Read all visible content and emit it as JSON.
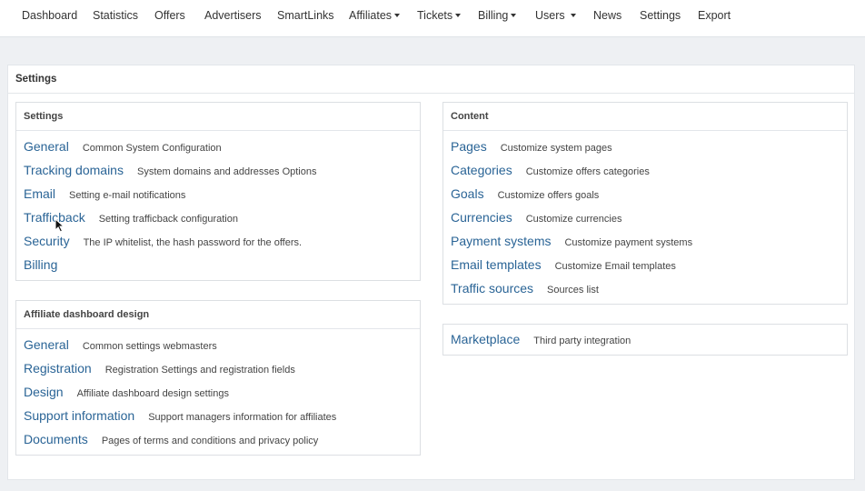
{
  "nav": {
    "items": [
      {
        "label": "Dashboard",
        "dropdown": false
      },
      {
        "label": "Statistics",
        "dropdown": false
      },
      {
        "label": "Offers",
        "dropdown": false
      },
      {
        "label": "Advertisers",
        "dropdown": false
      },
      {
        "label": "SmartLinks",
        "dropdown": false
      },
      {
        "label": "Affiliates",
        "dropdown": true
      },
      {
        "label": "Tickets",
        "dropdown": true
      },
      {
        "label": "Billing",
        "dropdown": true
      },
      {
        "label": "Users",
        "dropdown": true
      },
      {
        "label": "News",
        "dropdown": false
      },
      {
        "label": "Settings",
        "dropdown": false
      },
      {
        "label": "Export",
        "dropdown": false
      }
    ]
  },
  "main": {
    "title": "Settings"
  },
  "settings_panel": {
    "title": "Settings",
    "rows": [
      {
        "link": "General",
        "desc": "Common System Configuration"
      },
      {
        "link": "Tracking domains",
        "desc": "System domains and addresses Options"
      },
      {
        "link": "Email",
        "desc": "Setting e-mail notifications"
      },
      {
        "link": "Trafficback",
        "desc": "Setting trafficback configuration"
      },
      {
        "link": "Security",
        "desc": "The IP whitelist, the hash password for the offers."
      },
      {
        "link": "Billing",
        "desc": ""
      }
    ]
  },
  "affiliate_panel": {
    "title": "Affiliate dashboard design",
    "rows": [
      {
        "link": "General",
        "desc": "Common settings webmasters"
      },
      {
        "link": "Registration",
        "desc": "Registration Settings and registration fields"
      },
      {
        "link": "Design",
        "desc": "Affiliate dashboard design settings"
      },
      {
        "link": "Support information",
        "desc": "Support managers information for affiliates"
      },
      {
        "link": "Documents",
        "desc": "Pages of terms and conditions and privacy policy"
      }
    ]
  },
  "content_panel": {
    "title": "Content",
    "rows": [
      {
        "link": "Pages",
        "desc": "Customize system pages"
      },
      {
        "link": "Categories",
        "desc": "Customize offers categories"
      },
      {
        "link": "Goals",
        "desc": "Customize offers goals"
      },
      {
        "link": "Currencies",
        "desc": "Customize currencies"
      },
      {
        "link": "Payment systems",
        "desc": "Customize payment systems"
      },
      {
        "link": "Email templates",
        "desc": "Customize Email templates"
      },
      {
        "link": "Traffic sources",
        "desc": "Sources list"
      }
    ]
  },
  "marketplace_panel": {
    "rows": [
      {
        "link": "Marketplace",
        "desc": "Third party integration"
      }
    ]
  },
  "icons": {
    "caret": "caret-down-icon",
    "cursor": "mouse-pointer-icon"
  },
  "colors": {
    "link": "#2a6496",
    "background": "#eef0f3",
    "panel": "#ffffff"
  }
}
